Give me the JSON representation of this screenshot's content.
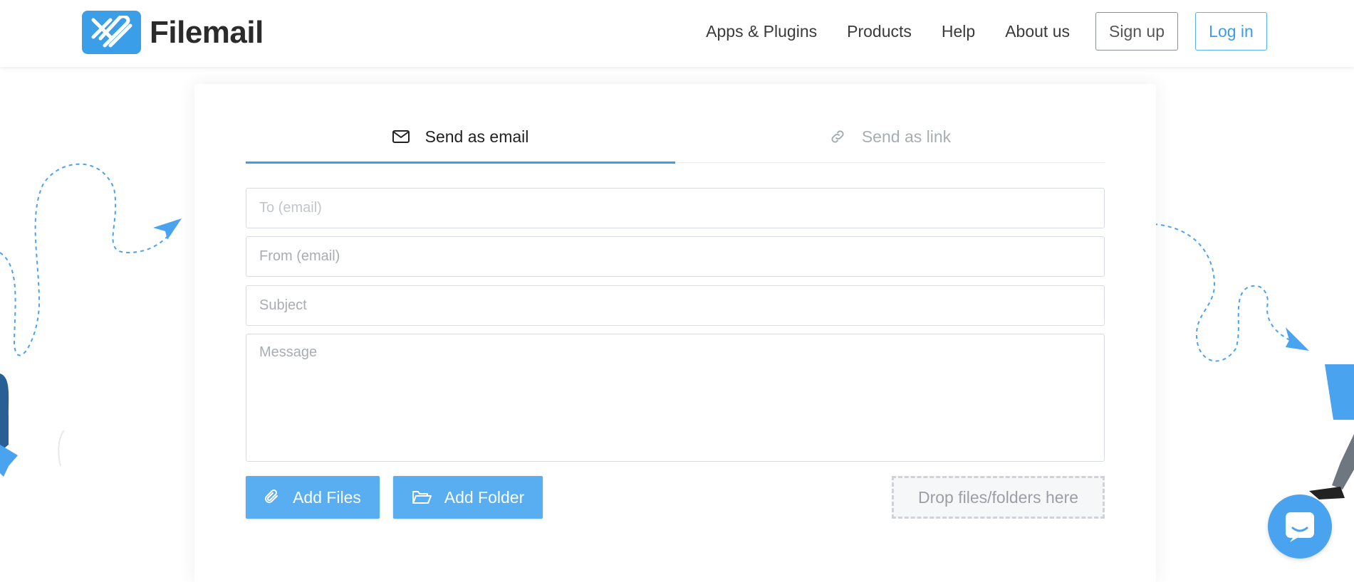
{
  "brand": {
    "name": "Filemail",
    "color": "#3a9fe8"
  },
  "nav": {
    "items": [
      "Apps & Plugins",
      "Products",
      "Help",
      "About us"
    ],
    "signup_label": "Sign up",
    "login_label": "Log in"
  },
  "tabs": [
    {
      "label": "Send as email",
      "icon": "envelope-icon",
      "active": true
    },
    {
      "label": "Send as link",
      "icon": "link-icon",
      "active": false
    }
  ],
  "form": {
    "to_placeholder": "To (email)",
    "from_placeholder": "From (email)",
    "subject_placeholder": "Subject",
    "message_placeholder": "Message"
  },
  "buttons": {
    "add_files": "Add Files",
    "add_folder": "Add Folder"
  },
  "dropzone_label": "Drop files/folders here",
  "colors": {
    "accent": "#58aef0",
    "text": "#333333",
    "muted": "#a8adb3"
  }
}
